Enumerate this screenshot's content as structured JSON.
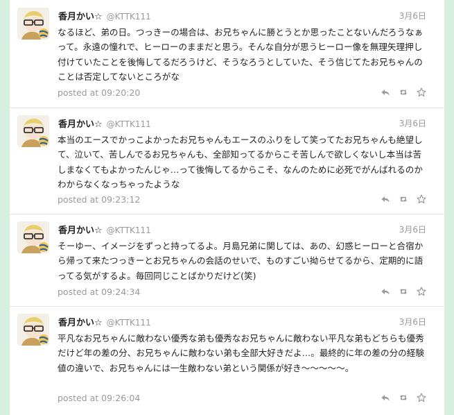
{
  "tweets": [
    {
      "name": "香月かい☆",
      "handle": "@KTTK111",
      "date": "3月6日",
      "text": "なるほど、弟の日。つっきーの場合は、お兄ちゃんに勝とうとか思ったことないんだろうなぁって。永遠の憧れで、ヒーローのままだと思う。そんな自分が思うヒーロー像を無理矢理押し付けていたことを後悔してるだろうけど、そうなろうとしていた、そう信じてたお兄ちゃんのことは否定してないところがな",
      "posted": "posted at 09:20:20"
    },
    {
      "name": "香月かい☆",
      "handle": "@KTTK111",
      "date": "3月6日",
      "text": "本当のエースでかっこよかったお兄ちゃんもエースのふりをして笑ってたお兄ちゃんも絶望して、泣いて、苦しんでるお兄ちゃんも、全部知ってるからこそ苦しんで欲しくないし本当は苦しまなくてもよかったんじゃ…って後悔してるからこそ、なんのために必死でがんばれるのかわからなくなっちゃったような",
      "posted": "posted at 09:23:12"
    },
    {
      "name": "香月かい☆",
      "handle": "@KTTK111",
      "date": "3月6日",
      "text": "そーゆー、イメージをずっと持ってるよ。月島兄弟に関しては、あの、幻惑ヒーローと合宿から帰って来たつっきーとお兄ちゃんの会話のせいで、ものすごい拗らせてるから、定期的に語ってる気がするよ。毎回同じことばかりだけど(笑)",
      "posted": "posted at 09:24:34"
    },
    {
      "name": "香月かい☆",
      "handle": "@KTTK111",
      "date": "3月6日",
      "text": "平凡なお兄ちゃんに敵わない優秀な弟も優秀なお兄ちゃんに敵わない平凡な弟もどちらも優秀だけど年の差の分、お兄ちゃんに敵わない弟も全部大好きだよ…。最終的に年の差の分の経験値の違いで、お兄ちゃんには一生敵わない弟という関係が好き〜〜〜〜〜。",
      "posted": "posted at 09:26:04"
    }
  ],
  "icons": [
    "reply-icon",
    "retweet-icon",
    "favorite-icon"
  ],
  "colors": {
    "background": "#d6efe0",
    "meta": "#999999"
  }
}
